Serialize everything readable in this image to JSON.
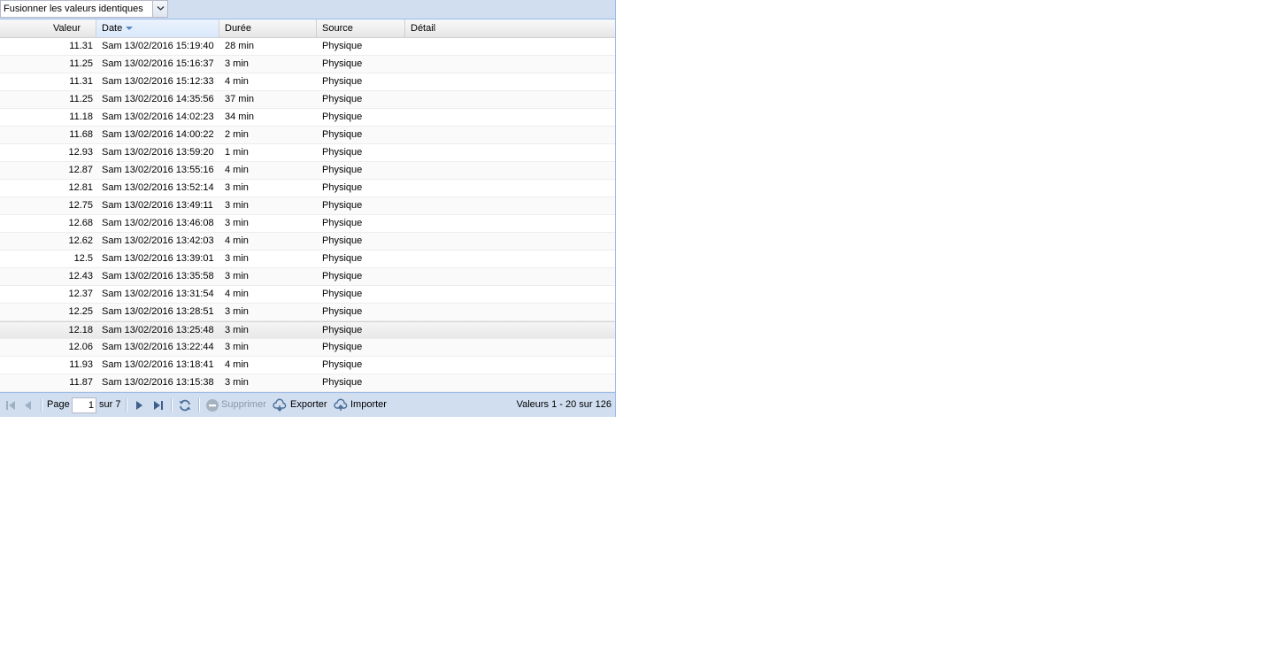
{
  "toolbar": {
    "merge_combo_value": "Fusionner les valeurs identiques"
  },
  "columns": {
    "valeur": "Valeur",
    "date": "Date",
    "duree": "Durée",
    "source": "Source",
    "detail": "Détail"
  },
  "rows": [
    {
      "valeur": "11.31",
      "date": "Sam 13/02/2016 15:19:40",
      "duree": "28 min",
      "source": "Physique",
      "detail": ""
    },
    {
      "valeur": "11.25",
      "date": "Sam 13/02/2016 15:16:37",
      "duree": "3 min",
      "source": "Physique",
      "detail": ""
    },
    {
      "valeur": "11.31",
      "date": "Sam 13/02/2016 15:12:33",
      "duree": "4 min",
      "source": "Physique",
      "detail": ""
    },
    {
      "valeur": "11.25",
      "date": "Sam 13/02/2016 14:35:56",
      "duree": "37 min",
      "source": "Physique",
      "detail": ""
    },
    {
      "valeur": "11.18",
      "date": "Sam 13/02/2016 14:02:23",
      "duree": "34 min",
      "source": "Physique",
      "detail": ""
    },
    {
      "valeur": "11.68",
      "date": "Sam 13/02/2016 14:00:22",
      "duree": "2 min",
      "source": "Physique",
      "detail": ""
    },
    {
      "valeur": "12.93",
      "date": "Sam 13/02/2016 13:59:20",
      "duree": "1 min",
      "source": "Physique",
      "detail": ""
    },
    {
      "valeur": "12.87",
      "date": "Sam 13/02/2016 13:55:16",
      "duree": "4 min",
      "source": "Physique",
      "detail": ""
    },
    {
      "valeur": "12.81",
      "date": "Sam 13/02/2016 13:52:14",
      "duree": "3 min",
      "source": "Physique",
      "detail": ""
    },
    {
      "valeur": "12.75",
      "date": "Sam 13/02/2016 13:49:11",
      "duree": "3 min",
      "source": "Physique",
      "detail": ""
    },
    {
      "valeur": "12.68",
      "date": "Sam 13/02/2016 13:46:08",
      "duree": "3 min",
      "source": "Physique",
      "detail": ""
    },
    {
      "valeur": "12.62",
      "date": "Sam 13/02/2016 13:42:03",
      "duree": "4 min",
      "source": "Physique",
      "detail": ""
    },
    {
      "valeur": "12.5",
      "date": "Sam 13/02/2016 13:39:01",
      "duree": "3 min",
      "source": "Physique",
      "detail": ""
    },
    {
      "valeur": "12.43",
      "date": "Sam 13/02/2016 13:35:58",
      "duree": "3 min",
      "source": "Physique",
      "detail": ""
    },
    {
      "valeur": "12.37",
      "date": "Sam 13/02/2016 13:31:54",
      "duree": "4 min",
      "source": "Physique",
      "detail": ""
    },
    {
      "valeur": "12.25",
      "date": "Sam 13/02/2016 13:28:51",
      "duree": "3 min",
      "source": "Physique",
      "detail": ""
    },
    {
      "valeur": "12.18",
      "date": "Sam 13/02/2016 13:25:48",
      "duree": "3 min",
      "source": "Physique",
      "detail": ""
    },
    {
      "valeur": "12.06",
      "date": "Sam 13/02/2016 13:22:44",
      "duree": "3 min",
      "source": "Physique",
      "detail": ""
    },
    {
      "valeur": "11.93",
      "date": "Sam 13/02/2016 13:18:41",
      "duree": "4 min",
      "source": "Physique",
      "detail": ""
    },
    {
      "valeur": "11.87",
      "date": "Sam 13/02/2016 13:15:38",
      "duree": "3 min",
      "source": "Physique",
      "detail": ""
    }
  ],
  "selected_row_index": 16,
  "paging": {
    "page_label": "Page",
    "page_value": "1",
    "of_label": "sur 7",
    "delete_label": "Supprimer",
    "export_label": "Exporter",
    "import_label": "Importer",
    "summary": "Valeurs 1 - 20 sur 126"
  },
  "icons": {
    "first": "first-page-icon",
    "prev": "prev-page-icon",
    "next": "next-page-icon",
    "last": "last-page-icon",
    "refresh": "refresh-icon",
    "delete": "delete-icon",
    "export": "cloud-download-icon",
    "import": "cloud-upload-icon",
    "sort": "sort-desc-icon",
    "combo": "chevron-down-icon"
  },
  "colors": {
    "toolbar_bg": "#d0def0",
    "border": "#99bbe8",
    "sort_arrow": "#5b87c3"
  }
}
